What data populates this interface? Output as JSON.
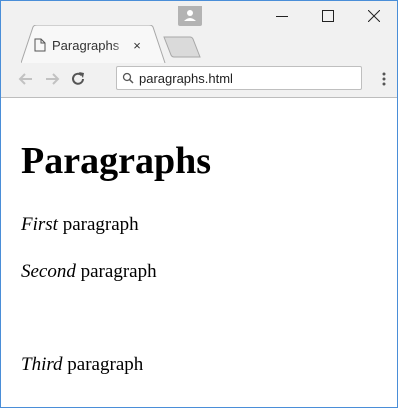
{
  "browser": {
    "tab": {
      "title": "Paragraphs",
      "close_glyph": "×",
      "favicon": "page-icon"
    },
    "window_controls": {
      "minimize": "minimize-icon",
      "maximize": "maximize-icon",
      "close": "close-icon"
    },
    "toolbar": {
      "back": "back-arrow-icon",
      "forward": "forward-arrow-icon",
      "reload": "reload-icon",
      "address_icon": "search-icon",
      "address": "paragraphs.html",
      "menu": "more-vert-icon"
    }
  },
  "page": {
    "heading": "Paragraphs",
    "paragraphs": [
      {
        "em": "First",
        "text": " paragraph"
      },
      {
        "em": "Second",
        "text": " paragraph"
      },
      {
        "em": "Third",
        "text": " paragraph"
      }
    ]
  },
  "colors": {
    "window_border": "#4a8ed8",
    "chrome_bg": "#f1f1f1",
    "profile": "#b3b3b3"
  }
}
